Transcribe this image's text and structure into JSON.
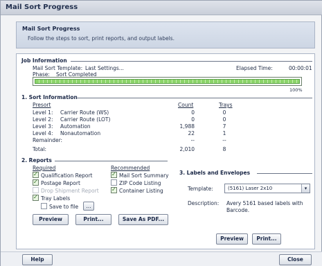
{
  "window": {
    "title": "Mail Sort Progress"
  },
  "header": {
    "title": "Mail Sort Progress",
    "subtitle": "Follow the steps to sort, print reports, and output labels."
  },
  "job": {
    "section": "Job Information",
    "template_label": "Mail Sort Template:",
    "template_value": "Last Settings...",
    "elapsed_label": "Elapsed Time:",
    "elapsed_value": "00:00:01",
    "phase_label": "Phase:",
    "phase_value": "Sort Completed",
    "progress_percent": 100,
    "progress_text": "100%"
  },
  "sort": {
    "section": "1. Sort Information",
    "col_presort": "Presort",
    "col_count": "Count",
    "col_trays": "Trays",
    "rows": [
      {
        "level": "Level 1:",
        "name": "Carrier Route (WS)",
        "count": "0",
        "trays": "0"
      },
      {
        "level": "Level 2:",
        "name": "Carrier Route (LOT)",
        "count": "0",
        "trays": "0"
      },
      {
        "level": "Level 3:",
        "name": "Automation",
        "count": "1,988",
        "trays": "7"
      },
      {
        "level": "Level 4:",
        "name": "Nonautomation",
        "count": "22",
        "trays": "1"
      },
      {
        "level": "Remainder:",
        "name": "",
        "count": "--",
        "trays": "--"
      },
      {
        "level": "Total:",
        "name": "",
        "count": "2,010",
        "trays": "8"
      }
    ]
  },
  "reports": {
    "section": "2. Reports",
    "required_label": "Required",
    "recommended_label": "Recommended",
    "qualification": "Qualification Report",
    "postage": "Postage Report",
    "drop_shipment": "Drop Shipment Report",
    "tray_labels": "Tray Labels",
    "save_to_file": "Save to file",
    "browse": "...",
    "mail_sort_summary": "Mail Sort Summary",
    "zip_code_listing": "ZIP Code Listing",
    "container_listing": "Container Listing",
    "preview": "Preview",
    "print": "Print...",
    "save_pdf": "Save As PDF..."
  },
  "labels": {
    "section": "3. Labels and Envelopes",
    "template_label": "Template:",
    "template_value": "(5161) Laser 2x10",
    "description_label": "Description:",
    "description_line1": "Avery 5161 based labels with",
    "description_line2": "Barcode.",
    "preview": "Preview",
    "print": "Print..."
  },
  "footer": {
    "help": "Help",
    "close": "Close"
  }
}
